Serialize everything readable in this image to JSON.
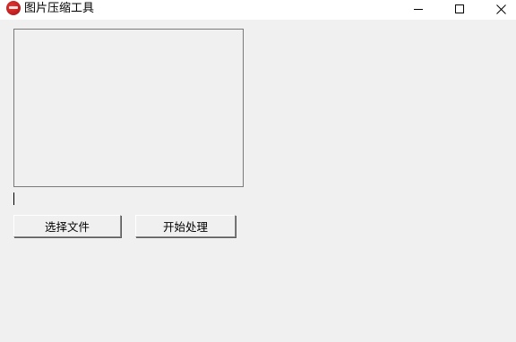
{
  "window": {
    "title": "图片压缩工具",
    "app_icon": "app-logo-icon",
    "controls": {
      "minimize_icon": "minimize-icon",
      "maximize_icon": "maximize-icon",
      "close_icon": "close-icon"
    }
  },
  "main": {
    "preview_box": {
      "content": ""
    },
    "path_field": {
      "value": ""
    },
    "buttons": {
      "select_file_label": "选择文件",
      "start_process_label": "开始处理"
    }
  },
  "colors": {
    "background": "#f0f0f0",
    "titlebar": "#ffffff",
    "border": "#7a7a7a"
  }
}
